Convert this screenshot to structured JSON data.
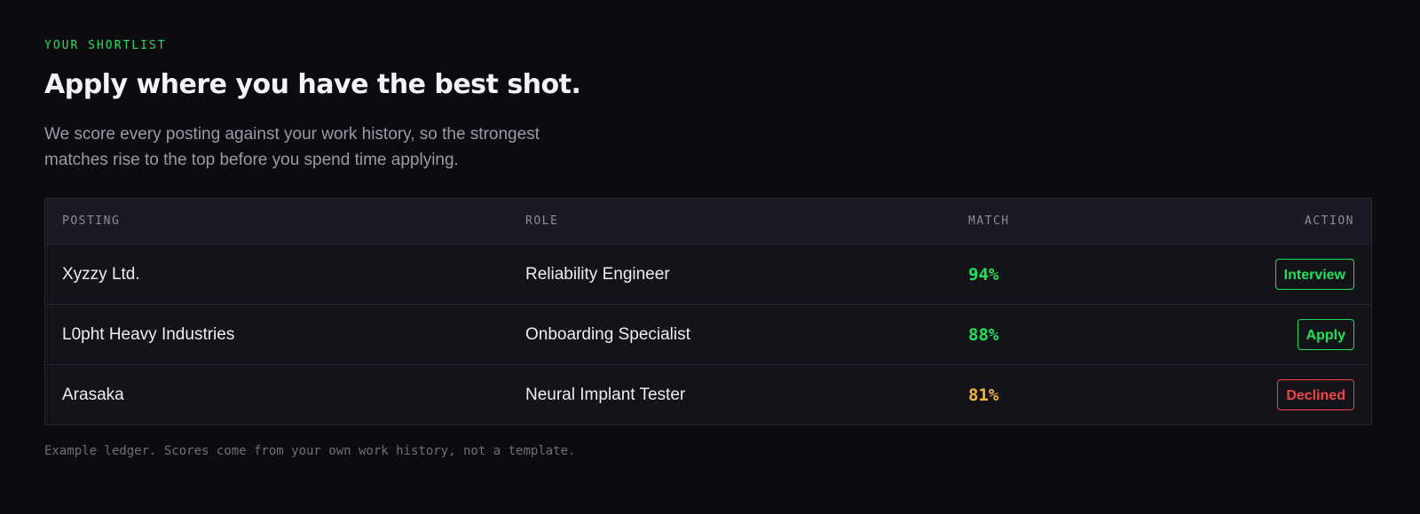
{
  "header": {
    "eyebrow": "YOUR SHORTLIST",
    "title": "Apply where you have the best shot.",
    "lede": "We score every posting against your work history, so the strongest matches rise to the top before you spend time applying."
  },
  "ledger": {
    "columns": {
      "posting": "POSTING",
      "role": "ROLE",
      "match": "MATCH",
      "action": "ACTION"
    },
    "rows": [
      {
        "posting": "Xyzzy Ltd.",
        "role": "Reliability Engineer",
        "match": "94%",
        "match_color": "#22e05a",
        "action": "Interview",
        "action_color": "#22e05a"
      },
      {
        "posting": "L0pht Heavy Industries",
        "role": "Onboarding Specialist",
        "match": "88%",
        "match_color": "#22e05a",
        "action": "Apply",
        "action_color": "#22e05a"
      },
      {
        "posting": "Arasaka",
        "role": "Neural Implant Tester",
        "match": "81%",
        "match_color": "#f5b53d",
        "action": "Declined",
        "action_color": "#ef4646"
      }
    ]
  },
  "footnote": "Example ledger. Scores come from your own work history, not a template."
}
